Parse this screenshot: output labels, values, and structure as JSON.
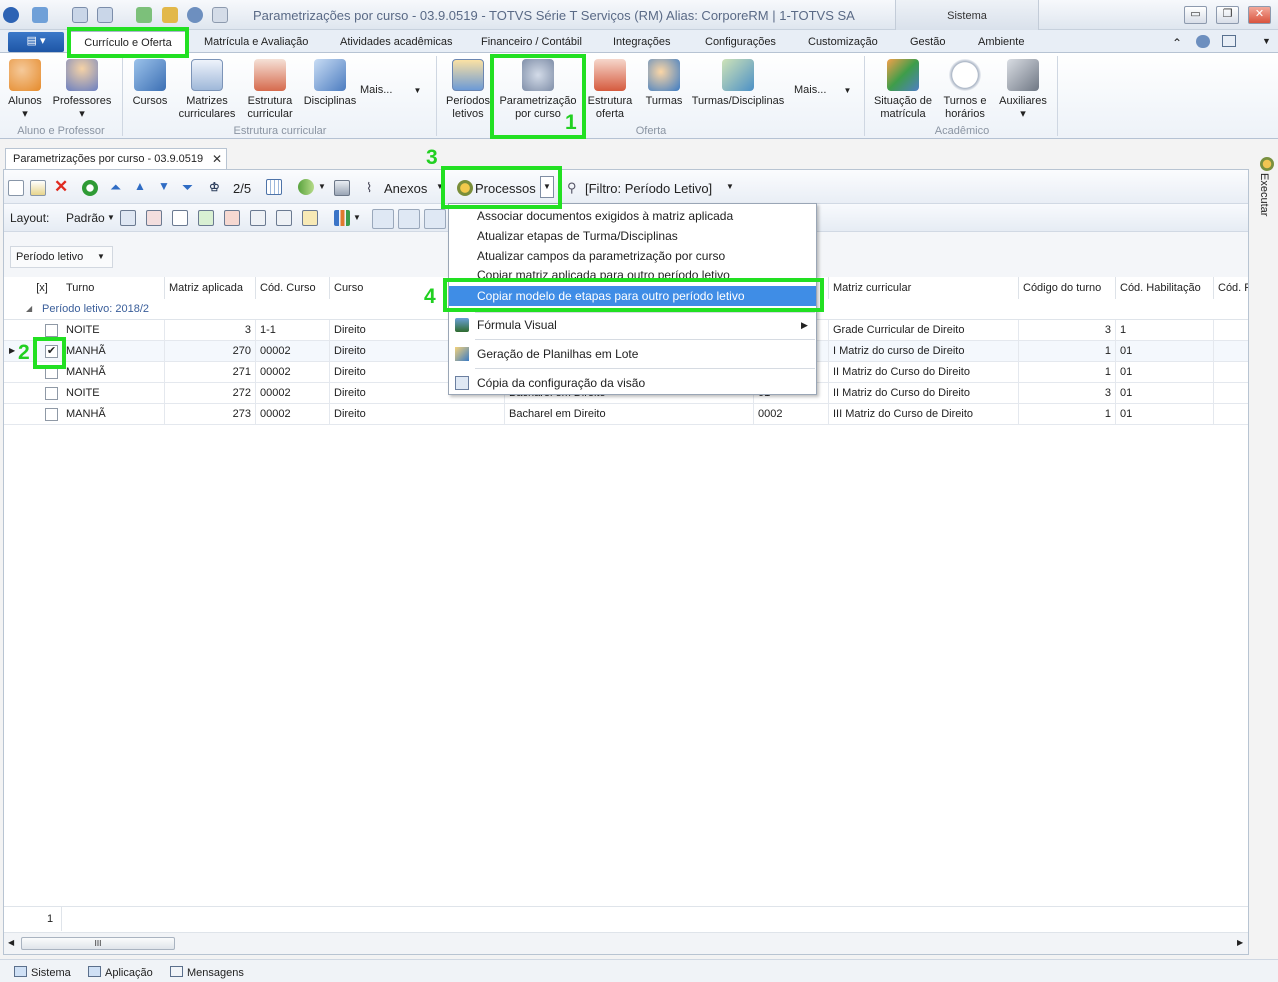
{
  "window": {
    "title": "Parametrizações por curso - 03.9.0519 - TOTVS Série T Serviços (RM) Alias: CorporeRM | 1-TOTVS SA",
    "system_tab": "Sistema",
    "buttons": {
      "minimize": "▭",
      "restore": "❐",
      "close": "✕"
    }
  },
  "menubar": {
    "tabs": [
      "Currículo e Oferta",
      "Matrícula e Avaliação",
      "Atividades acadêmicas",
      "Financeiro / Contábil",
      "Integrações",
      "Configurações",
      "Customização",
      "Gestão",
      "Ambiente"
    ]
  },
  "ribbon": {
    "items": [
      {
        "label": "Alunos",
        "sub": "▾"
      },
      {
        "label": "Professores",
        "sub": "▾"
      },
      {
        "label": "Cursos"
      },
      {
        "label": "Matrizes curriculares"
      },
      {
        "label": "Estrutura curricular"
      },
      {
        "label": "Disciplinas"
      },
      {
        "label": "Mais..."
      },
      {
        "label": "Períodos letivos"
      },
      {
        "label": "Parametrização por curso"
      },
      {
        "label": "Estrutura oferta"
      },
      {
        "label": "Turmas"
      },
      {
        "label": "Turmas/Disciplinas"
      },
      {
        "label": "Mais..."
      },
      {
        "label": "Situação de matrícula"
      },
      {
        "label": "Turnos e horários"
      },
      {
        "label": "Auxiliares",
        "sub": "▾"
      }
    ],
    "groups": [
      "Aluno e Professor",
      "Estrutura curricular",
      "Oferta",
      "Acadêmico"
    ]
  },
  "annotations": {
    "n1": "1",
    "n2": "2",
    "n3": "3",
    "n4": "4"
  },
  "doc_tab": {
    "title": "Parametrizações por curso - 03.9.0519",
    "close": "✕"
  },
  "toolbar": {
    "record_counter": "2/5",
    "anexos": "Anexos",
    "processos": "Processos",
    "filter": "[Filtro: Período Letivo]",
    "layout_label": "Layout:",
    "layout_value": "Padrão"
  },
  "group_by": "Período letivo",
  "grid": {
    "headers": [
      "[x]",
      "Turno",
      "Matriz aplicada",
      "Cód. Curso",
      "Curso",
      "",
      "",
      "Matriz curricular",
      "Código do turno",
      "Cód. Habilitação",
      "Cód. P"
    ],
    "group_label": "Período letivo: 2018/2",
    "rows": [
      {
        "turno": "NOITE",
        "matriz": "3",
        "cod_curso": "1-1",
        "curso": "Direito",
        "habilitacao": "",
        "cod_hab": "",
        "matriz_curricular": "Grade Curricular de Direito",
        "cod_turno": "3",
        "cod_habilitacao": "1",
        "checked": false
      },
      {
        "turno": "MANHÃ",
        "matriz": "270",
        "cod_curso": "00002",
        "curso": "Direito",
        "habilitacao": "",
        "cod_hab": "",
        "matriz_curricular": "I Matriz do curso de Direito",
        "cod_turno": "1",
        "cod_habilitacao": "01",
        "checked": true
      },
      {
        "turno": "MANHÃ",
        "matriz": "271",
        "cod_curso": "00002",
        "curso": "Direito",
        "habilitacao": "",
        "cod_hab": "",
        "matriz_curricular": "II Matriz do Curso do Direito",
        "cod_turno": "1",
        "cod_habilitacao": "01",
        "checked": false
      },
      {
        "turno": "NOITE",
        "matriz": "272",
        "cod_curso": "00002",
        "curso": "Direito",
        "habilitacao": "Bacharel em Direito",
        "cod_hab": "01",
        "matriz_curricular": "II Matriz do Curso do Direito",
        "cod_turno": "3",
        "cod_habilitacao": "01",
        "checked": false
      },
      {
        "turno": "MANHÃ",
        "matriz": "273",
        "cod_curso": "00002",
        "curso": "Direito",
        "habilitacao": "Bacharel em Direito",
        "cod_hab": "0002",
        "matriz_curricular": "III Matriz do Curso de Direito",
        "cod_turno": "1",
        "cod_habilitacao": "01",
        "checked": false
      }
    ],
    "footer_count": "1",
    "hscroll_thumb": "III"
  },
  "processos_menu": [
    "Associar documentos exigidos à matriz aplicada",
    "Atualizar etapas de Turma/Disciplinas",
    "Atualizar campos da parametrização por curso",
    "Copiar matriz aplicada para outro período letivo",
    "Copiar modelo de etapas para outro período letivo",
    "Fórmula Visual",
    "Geração de Planilhas em Lote",
    "Cópia da configuração da visão"
  ],
  "side_panel": "Executar",
  "bottombar": [
    "Sistema",
    "Aplicação",
    "Mensagens"
  ],
  "colors": {
    "highlight_green": "#22e022",
    "menu_selected": "#3f8de6",
    "title_text": "#5a6a86"
  }
}
